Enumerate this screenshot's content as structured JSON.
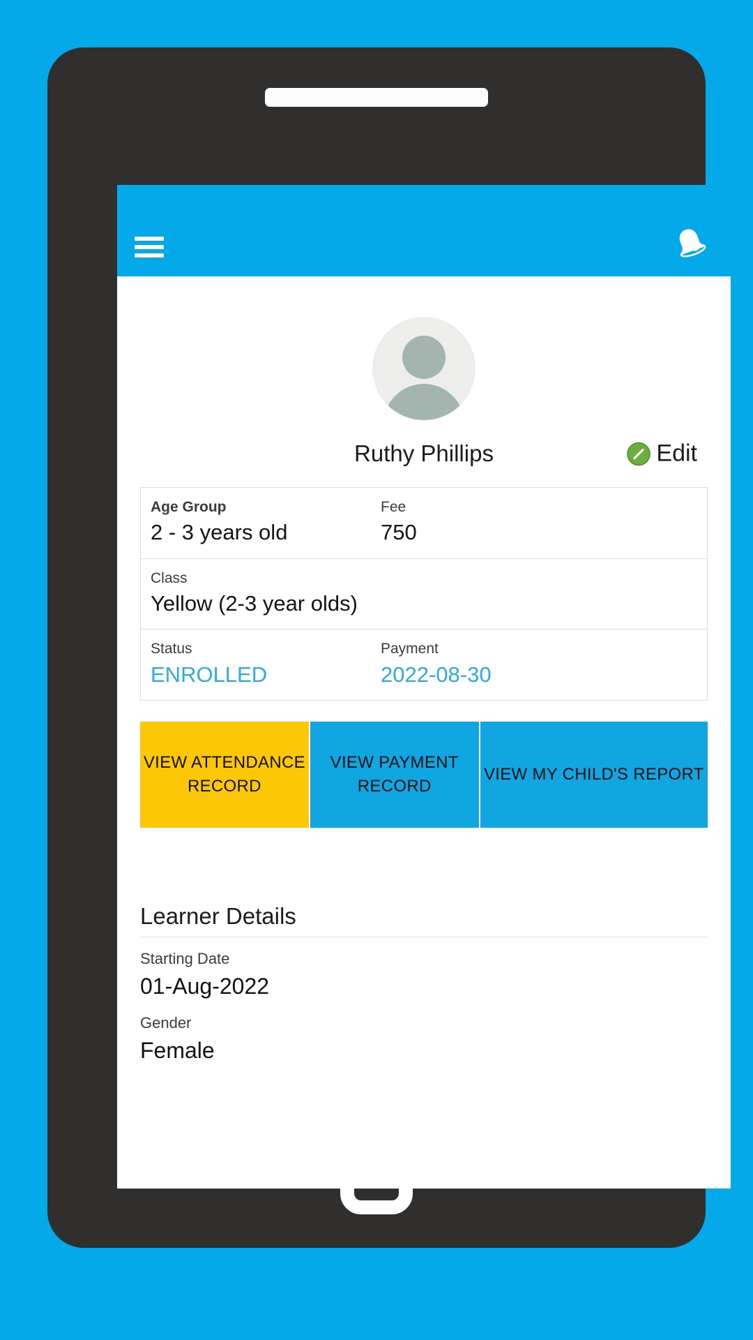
{
  "theme": {
    "page_background": "#03A9E8",
    "frame": "#312F2D",
    "appbar": "#03A9E8",
    "accent_blue": "#2BABE2",
    "button_yellow": "#FBC707",
    "button_blue": "#0FA6E2"
  },
  "appbar": {
    "menu_icon": "hamburger-menu-icon",
    "notification_icon": "bell-icon"
  },
  "profile": {
    "avatar_icon": "person-avatar-icon",
    "name": "Ruthy Phillips",
    "edit_label": "Edit",
    "edit_icon": "pencil-edit-icon"
  },
  "info_card": {
    "rows": [
      {
        "left": {
          "label": "Age Group",
          "value": "2 - 3 years old",
          "label_strong": true
        },
        "right": {
          "label": "Fee",
          "value": "750",
          "label_strong": false
        }
      },
      {
        "left": {
          "label": "Class",
          "value": "Yellow (2-3 year olds)",
          "label_strong": false
        },
        "right": null
      },
      {
        "left": {
          "label": "Status",
          "value": "ENROLLED",
          "accent": true
        },
        "right": {
          "label": "Payment",
          "value": "2022-08-30",
          "accent": true
        }
      }
    ]
  },
  "actions": [
    {
      "label": "VIEW ATTENDANCE RECORD",
      "color": "yellow"
    },
    {
      "label": "VIEW PAYMENT RECORD",
      "color": "blue"
    },
    {
      "label": "VIEW MY CHILD'S REPORT",
      "color": "blue"
    }
  ],
  "learner_details": {
    "title": "Learner Details",
    "items": [
      {
        "label": "Starting Date",
        "value": "01-Aug-2022"
      },
      {
        "label": "Gender",
        "value": "Female"
      }
    ]
  },
  "device": {
    "speaker_name": "speaker-grille",
    "home_button_name": "home-button"
  }
}
